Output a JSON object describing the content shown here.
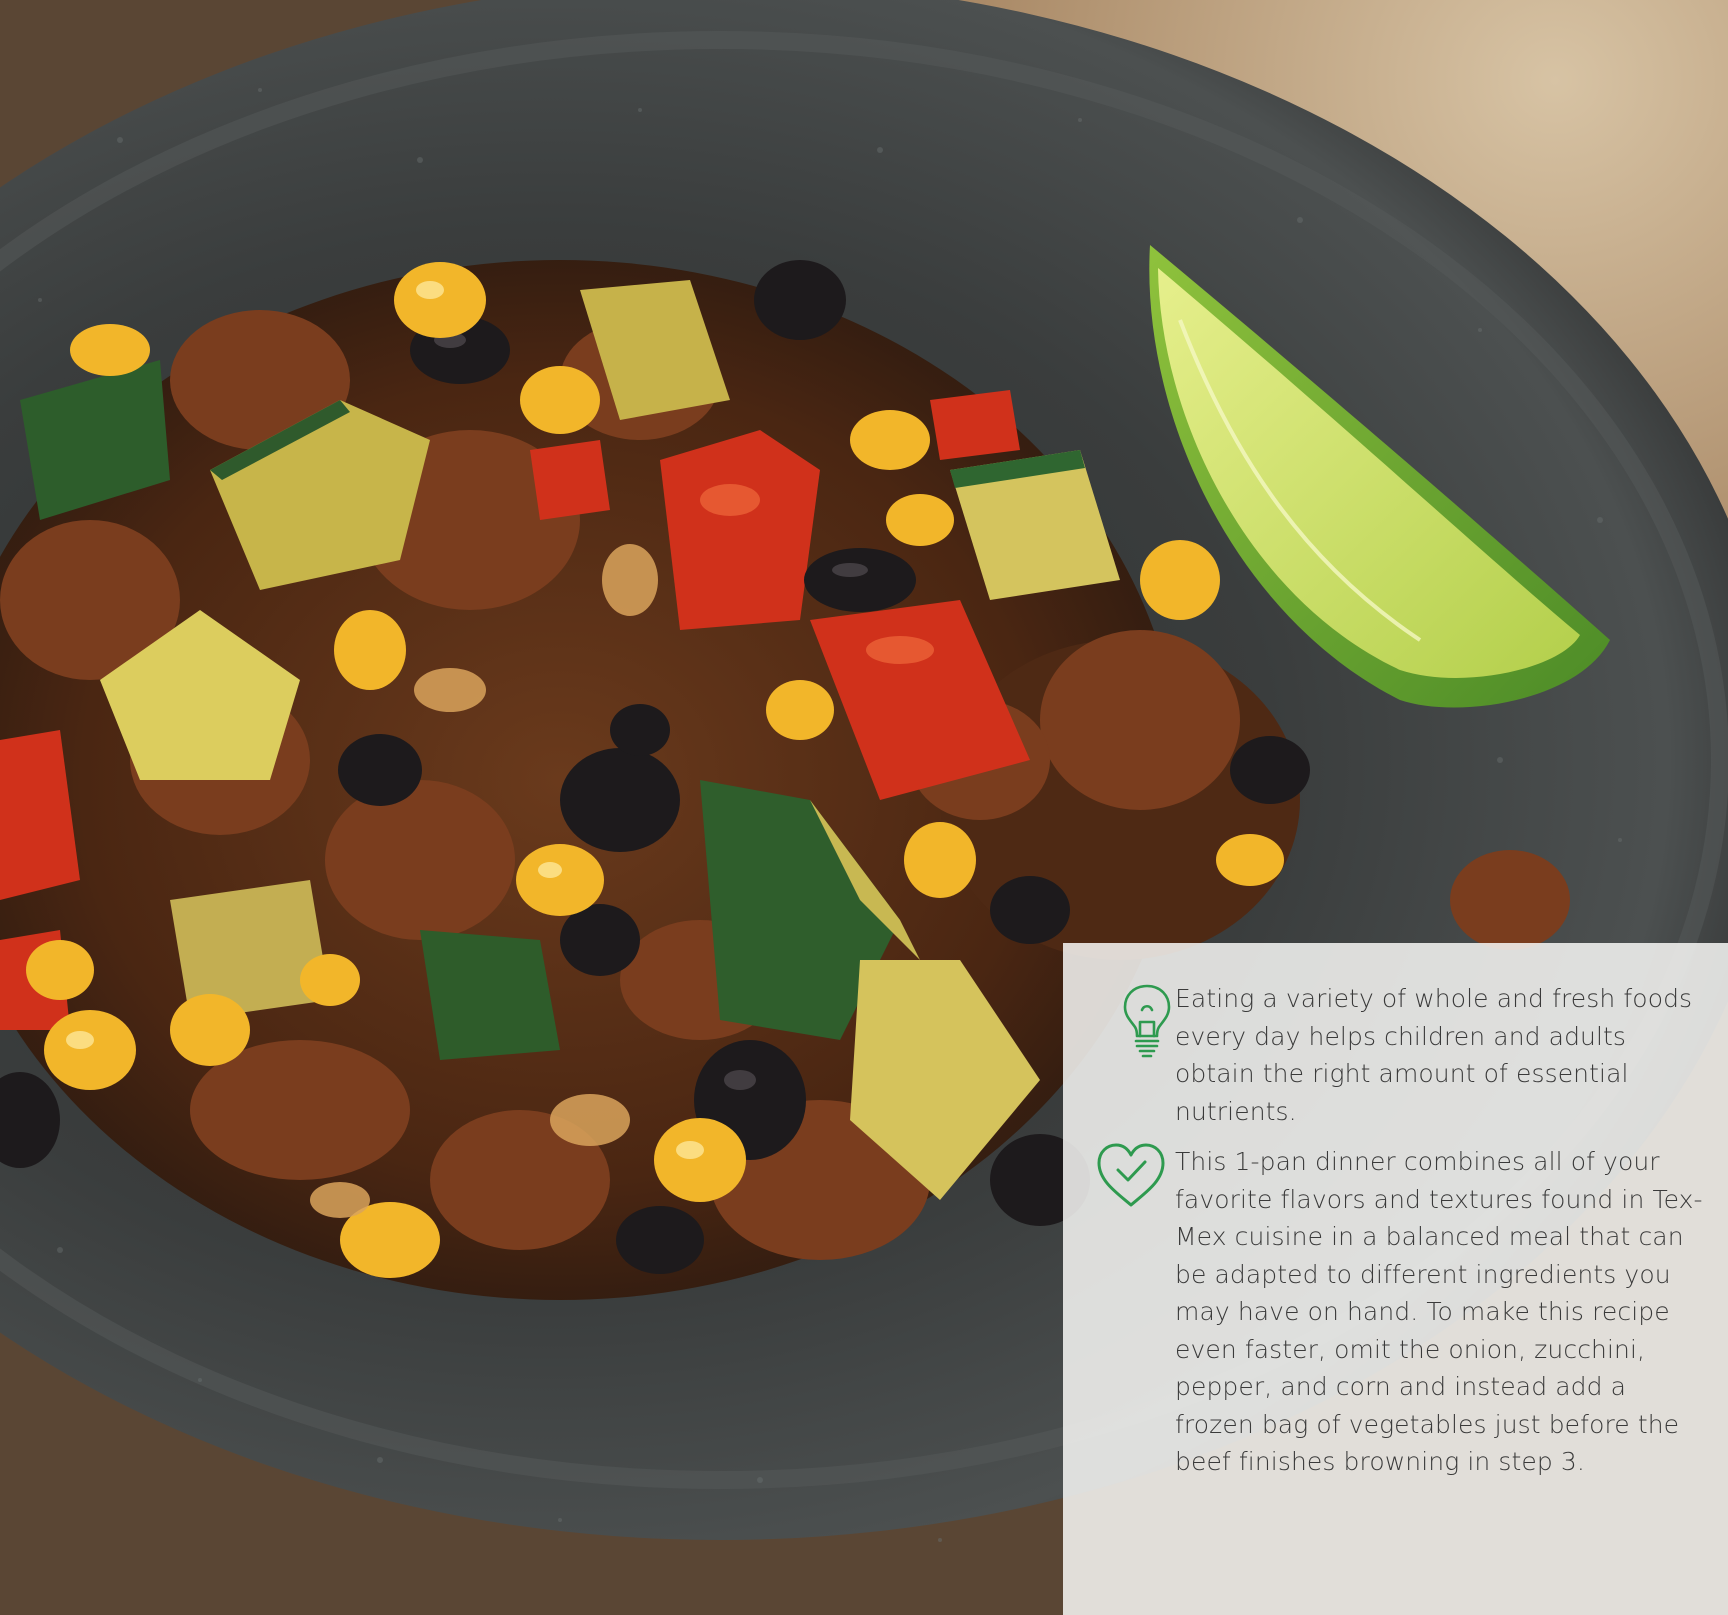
{
  "scene": {
    "accent_color": "#2e9a4f",
    "panel_color": "#f7f7f5"
  },
  "tips": [
    {
      "icon": "lightbulb-icon",
      "text": "Eating a variety of whole and fresh foods every day helps children and adults obtain the right amount of essential nutrients."
    },
    {
      "icon": "heart-check-icon",
      "text": "This 1-pan dinner combines all of your favorite flavors and textures found in Tex-Mex cuisine in a balanced meal that can be adapted to different ingredients you may have on hand. To make this recipe even faster, omit the onion, zucchini, pepper, and corn and instead add a frozen bag of vegetables just before the beef finishes browning in step 3."
    }
  ]
}
